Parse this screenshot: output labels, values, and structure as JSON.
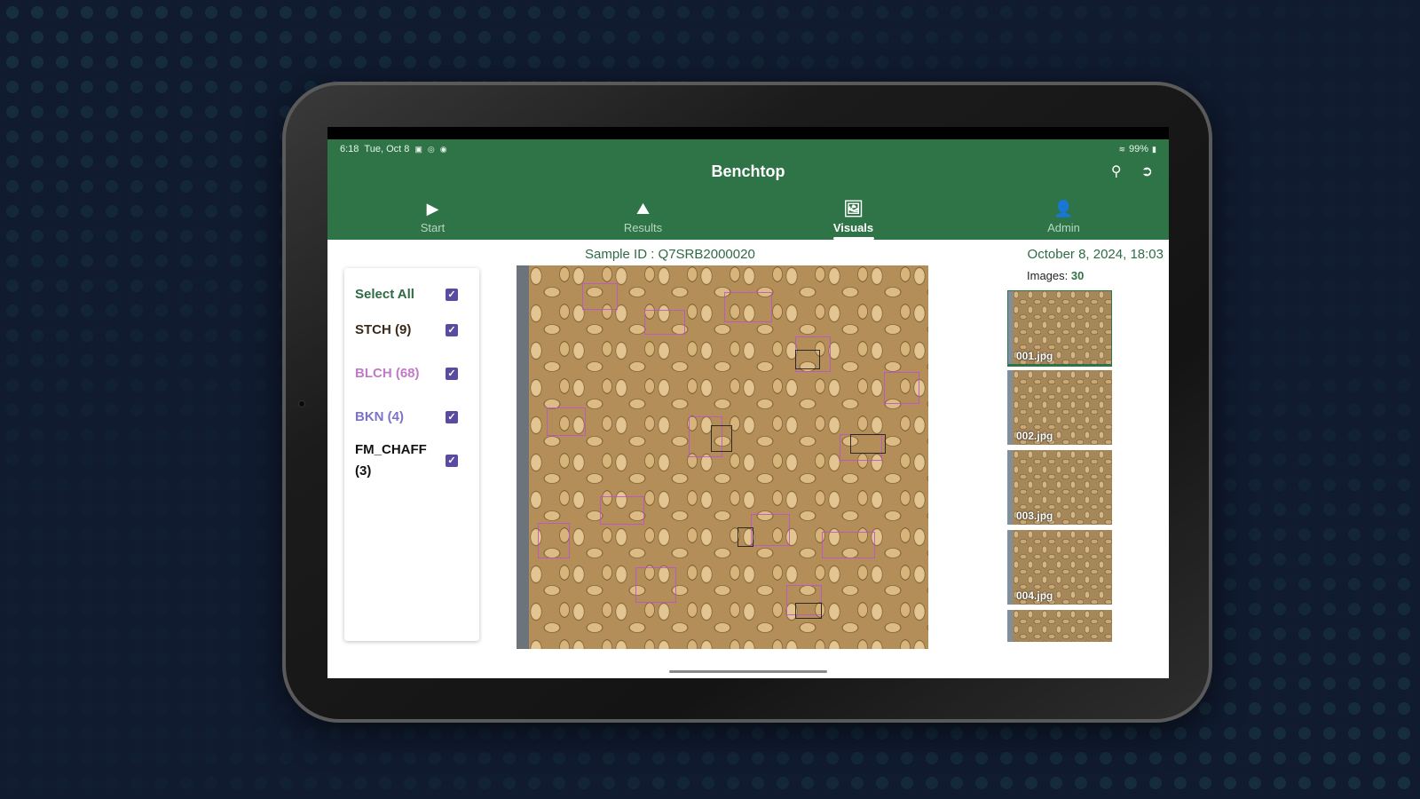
{
  "status_bar": {
    "time": "6:18",
    "date": "Tue, Oct 8",
    "battery": "99%"
  },
  "app": {
    "title": "Benchtop"
  },
  "tabs": [
    {
      "label": "Start",
      "icon": "play-icon",
      "active": false
    },
    {
      "label": "Results",
      "icon": "chart-icon",
      "active": false
    },
    {
      "label": "Visuals",
      "icon": "image-icon",
      "active": true
    },
    {
      "label": "Admin",
      "icon": "person-icon",
      "active": false
    }
  ],
  "sample": {
    "id_label": "Sample ID :",
    "id_value": "Q7SRB2000020",
    "datetime": "October 8, 2024, 18:03",
    "images_label": "Images:",
    "images_count": "30"
  },
  "filters": [
    {
      "label": "Select All",
      "color": "#2f6b45",
      "checked": true
    },
    {
      "label": "STCH (9)",
      "color": "#3a2a18",
      "checked": true
    },
    {
      "label": "BLCH (68)",
      "color": "#c07ac8",
      "checked": true
    },
    {
      "label": "BKN (4)",
      "color": "#7c72c8",
      "checked": true
    },
    {
      "label": "FM_CHAFF (3)",
      "color": "#111111",
      "checked": true
    }
  ],
  "thumbnails": [
    {
      "name": "001.jpg",
      "selected": true
    },
    {
      "name": "002.jpg",
      "selected": false
    },
    {
      "name": "003.jpg",
      "selected": false
    },
    {
      "name": "004.jpg",
      "selected": false
    },
    {
      "name": "",
      "selected": false
    }
  ],
  "colors": {
    "brand_green": "#2f7446",
    "checkbox_purple": "#5a4aa0"
  }
}
